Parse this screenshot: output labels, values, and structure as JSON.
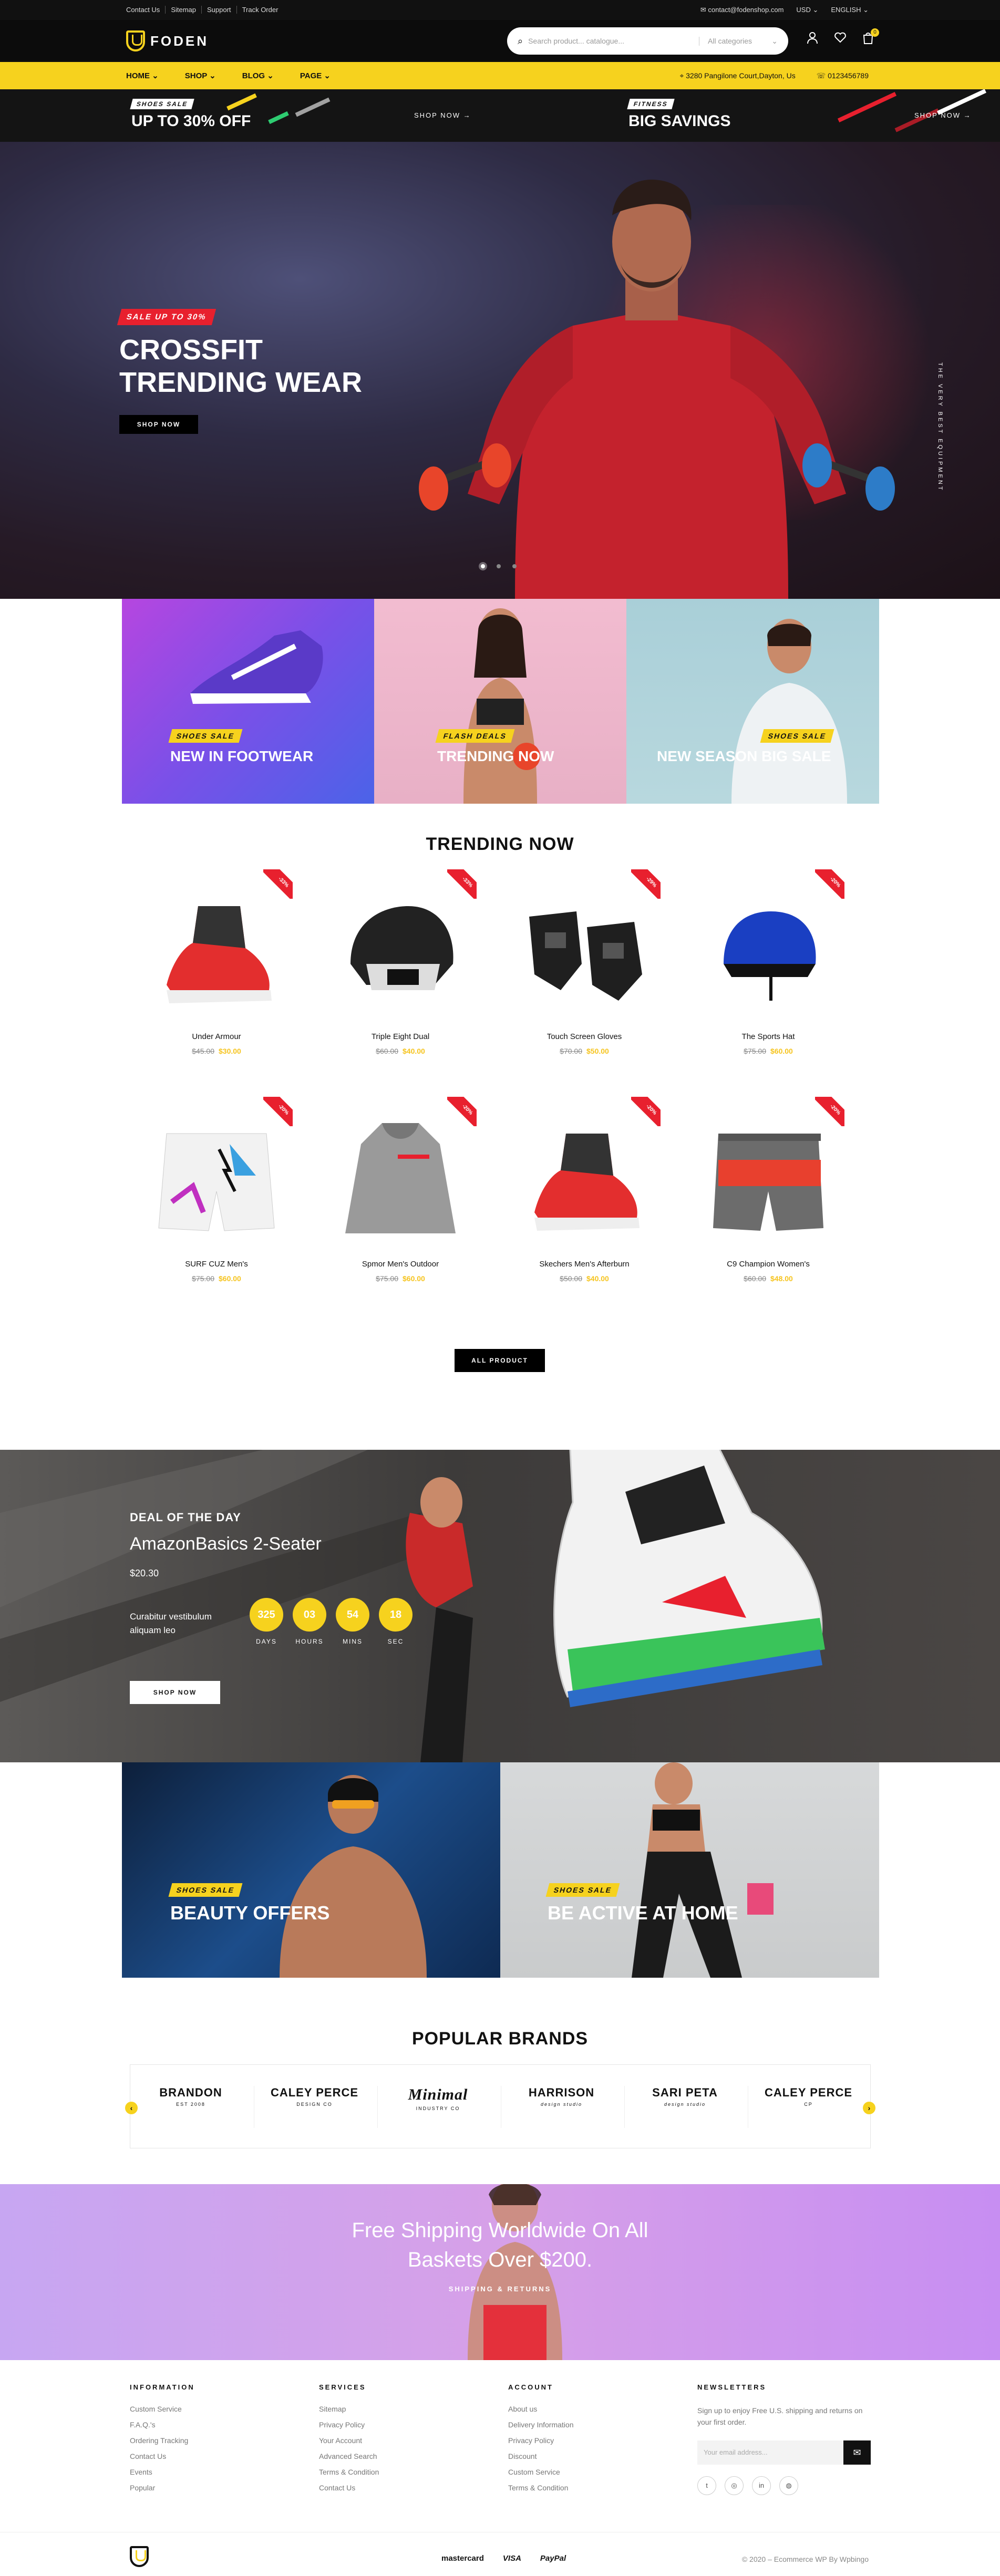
{
  "topbar": {
    "links": [
      "Contact Us",
      "Sitemap",
      "Support",
      "Track Order"
    ],
    "email": "contact@fodenshop.com",
    "currency": "USD",
    "language": "ENGLISH"
  },
  "header": {
    "brand": "FODEN",
    "search_placeholder": "Search product... catalogue...",
    "category": "All categories",
    "cart_count": "0"
  },
  "nav": {
    "items": [
      "HOME",
      "SHOP",
      "BLOG",
      "PAGE"
    ],
    "address": "3280 Pangilone Court,Dayton, Us",
    "phone": "0123456789"
  },
  "promos": [
    {
      "tag": "SHOES SALE",
      "title": "UP TO 30% OFF",
      "link": "SHOP NOW"
    },
    {
      "tag": "FITNESS",
      "title": "BIG SAVINGS",
      "link": "SHOP NOW"
    }
  ],
  "hero": {
    "badge": "SALE UP TO 30%",
    "title_line1": "CROSSFIT",
    "title_line2": "TRENDING WEAR",
    "button": "SHOP NOW",
    "side_text": "THE VERY BEST EQUIPMENT"
  },
  "categories": [
    {
      "tag": "SHOES SALE",
      "title": "NEW IN FOOTWEAR"
    },
    {
      "tag": "FLASH DEALS",
      "title": "TRENDING NOW"
    },
    {
      "tag": "SHOES SALE",
      "title": "NEW SEASON BIG SALE"
    }
  ],
  "trending": {
    "title": "TRENDING NOW",
    "products": [
      {
        "name": "Under Armour",
        "old": "$45.00",
        "new": "$30.00",
        "badge": "-33%"
      },
      {
        "name": "Triple Eight Dual",
        "old": "$60.00",
        "new": "$40.00",
        "badge": "-33%"
      },
      {
        "name": "Touch Screen Gloves",
        "old": "$70.00",
        "new": "$50.00",
        "badge": "-29%"
      },
      {
        "name": "The Sports Hat",
        "old": "$75.00",
        "new": "$60.00",
        "badge": "-20%"
      },
      {
        "name": "SURF CUZ Men's",
        "old": "$75.00",
        "new": "$60.00",
        "badge": "-20%"
      },
      {
        "name": "Spmor Men's Outdoor",
        "old": "$75.00",
        "new": "$60.00",
        "badge": "-20%"
      },
      {
        "name": "Skechers Men's Afterburn",
        "old": "$50.00",
        "new": "$40.00",
        "badge": "-20%"
      },
      {
        "name": "C9 Champion Women's",
        "old": "$60.00",
        "new": "$48.00",
        "badge": "-20%"
      }
    ],
    "button": "ALL PRODUCT"
  },
  "deal": {
    "kicker": "DEAL OF THE DAY",
    "title": "AmazonBasics 2-Seater",
    "price": "$20.30",
    "desc": "Curabitur vestibulum aliquam leo",
    "countdown": [
      {
        "num": "325",
        "label": "DAYS"
      },
      {
        "num": "03",
        "label": "HOURS"
      },
      {
        "num": "54",
        "label": "MINS"
      },
      {
        "num": "18",
        "label": "SEC"
      }
    ],
    "button": "SHOP NOW"
  },
  "offers": [
    {
      "tag": "SHOES SALE",
      "title": "BEAUTY OFFERS"
    },
    {
      "tag": "SHOES SALE",
      "title": "BE ACTIVE AT HOME"
    }
  ],
  "brands": {
    "title": "POPULAR BRANDS",
    "items": [
      {
        "name": "BRANDON",
        "sub": "EST 2008"
      },
      {
        "name": "CALEY PERCE",
        "sub": "DESIGN CO"
      },
      {
        "name": "Minimal",
        "sub": "INDUSTRY CO"
      },
      {
        "name": "HARRISON",
        "sub": "design studio"
      },
      {
        "name": "SARI PETA",
        "sub": "design studio"
      },
      {
        "name": "CALEY PERCE",
        "sub": "CP"
      }
    ]
  },
  "shipping": {
    "line1": "Free Shipping Worldwide On All",
    "line2": "Baskets Over $200.",
    "link": "SHIPPING & RETURNS"
  },
  "footer": {
    "columns": [
      {
        "title": "INFORMATION",
        "links": [
          "Custom Service",
          "F.A.Q.'s",
          "Ordering Tracking",
          "Contact Us",
          "Events",
          "Popular"
        ]
      },
      {
        "title": "SERVICES",
        "links": [
          "Sitemap",
          "Privacy Policy",
          "Your Account",
          "Advanced Search",
          "Terms & Condition",
          "Contact Us"
        ]
      },
      {
        "title": "ACCOUNT",
        "links": [
          "About us",
          "Delivery Information",
          "Privacy Policy",
          "Discount",
          "Custom Service",
          "Terms & Condition"
        ]
      }
    ],
    "newsletter": {
      "title": "NEWSLETTERS",
      "desc": "Sign up to enjoy Free U.S. shipping and returns on your first order.",
      "placeholder": "Your email address..."
    },
    "payments": [
      "mastercard",
      "VISA",
      "PayPal"
    ],
    "copyright": "© 2020 – Ecommerce WP By Wpbingo"
  },
  "colors": {
    "accent": "#f6d21e",
    "sale": "#e8202e",
    "dark": "#111111"
  }
}
